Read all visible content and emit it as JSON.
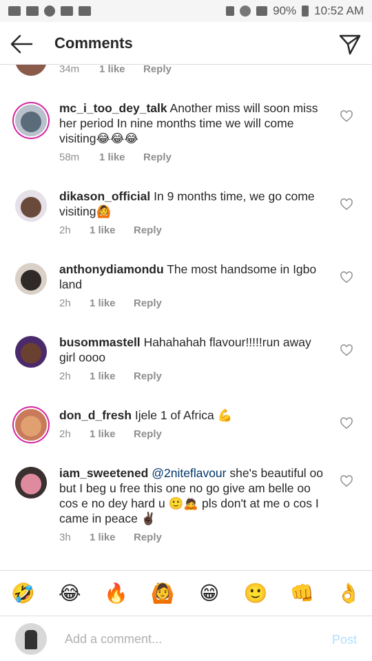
{
  "status_bar": {
    "battery": "90%",
    "time": "10:52 AM"
  },
  "header": {
    "title": "Comments"
  },
  "partial_comment": {
    "time": "34m",
    "likes": "1 like",
    "reply": "Reply"
  },
  "comments": [
    {
      "username": "mc_i_too_dey_talk",
      "text": "Another miss will soon miss her period In nine months time we will come visiting😂😂😂",
      "time": "58m",
      "likes": "1 like",
      "reply": "Reply"
    },
    {
      "username": "dikason_official",
      "text": "In 9 months time, we go come visiting🙆",
      "time": "2h",
      "likes": "1 like",
      "reply": "Reply"
    },
    {
      "username": "anthonydiamondu",
      "text": "The most handsome in Igbo land",
      "time": "2h",
      "likes": "1 like",
      "reply": "Reply"
    },
    {
      "username": "busommastell",
      "text": "Hahahahah flavour!!!!!run away girl oooo",
      "time": "2h",
      "likes": "1 like",
      "reply": "Reply"
    },
    {
      "username": "don_d_fresh",
      "text": "Ijele 1 of Africa 💪",
      "time": "2h",
      "likes": "1 like",
      "reply": "Reply"
    },
    {
      "username": "iam_sweetened",
      "mention": "@2niteflavour",
      "text": " she's beautiful oo but I beg u free this one no go give am belle oo cos e no dey hard u 🙂🙇 pls don't at me o cos I came in peace ✌🏿",
      "time": "3h",
      "likes": "1 like",
      "reply": "Reply"
    }
  ],
  "emoji_bar": [
    "🤣",
    "😂",
    "🔥",
    "🙆",
    "😁",
    "🙂",
    "👊",
    "👌"
  ],
  "compose": {
    "placeholder": "Add a comment...",
    "post_label": "Post"
  }
}
